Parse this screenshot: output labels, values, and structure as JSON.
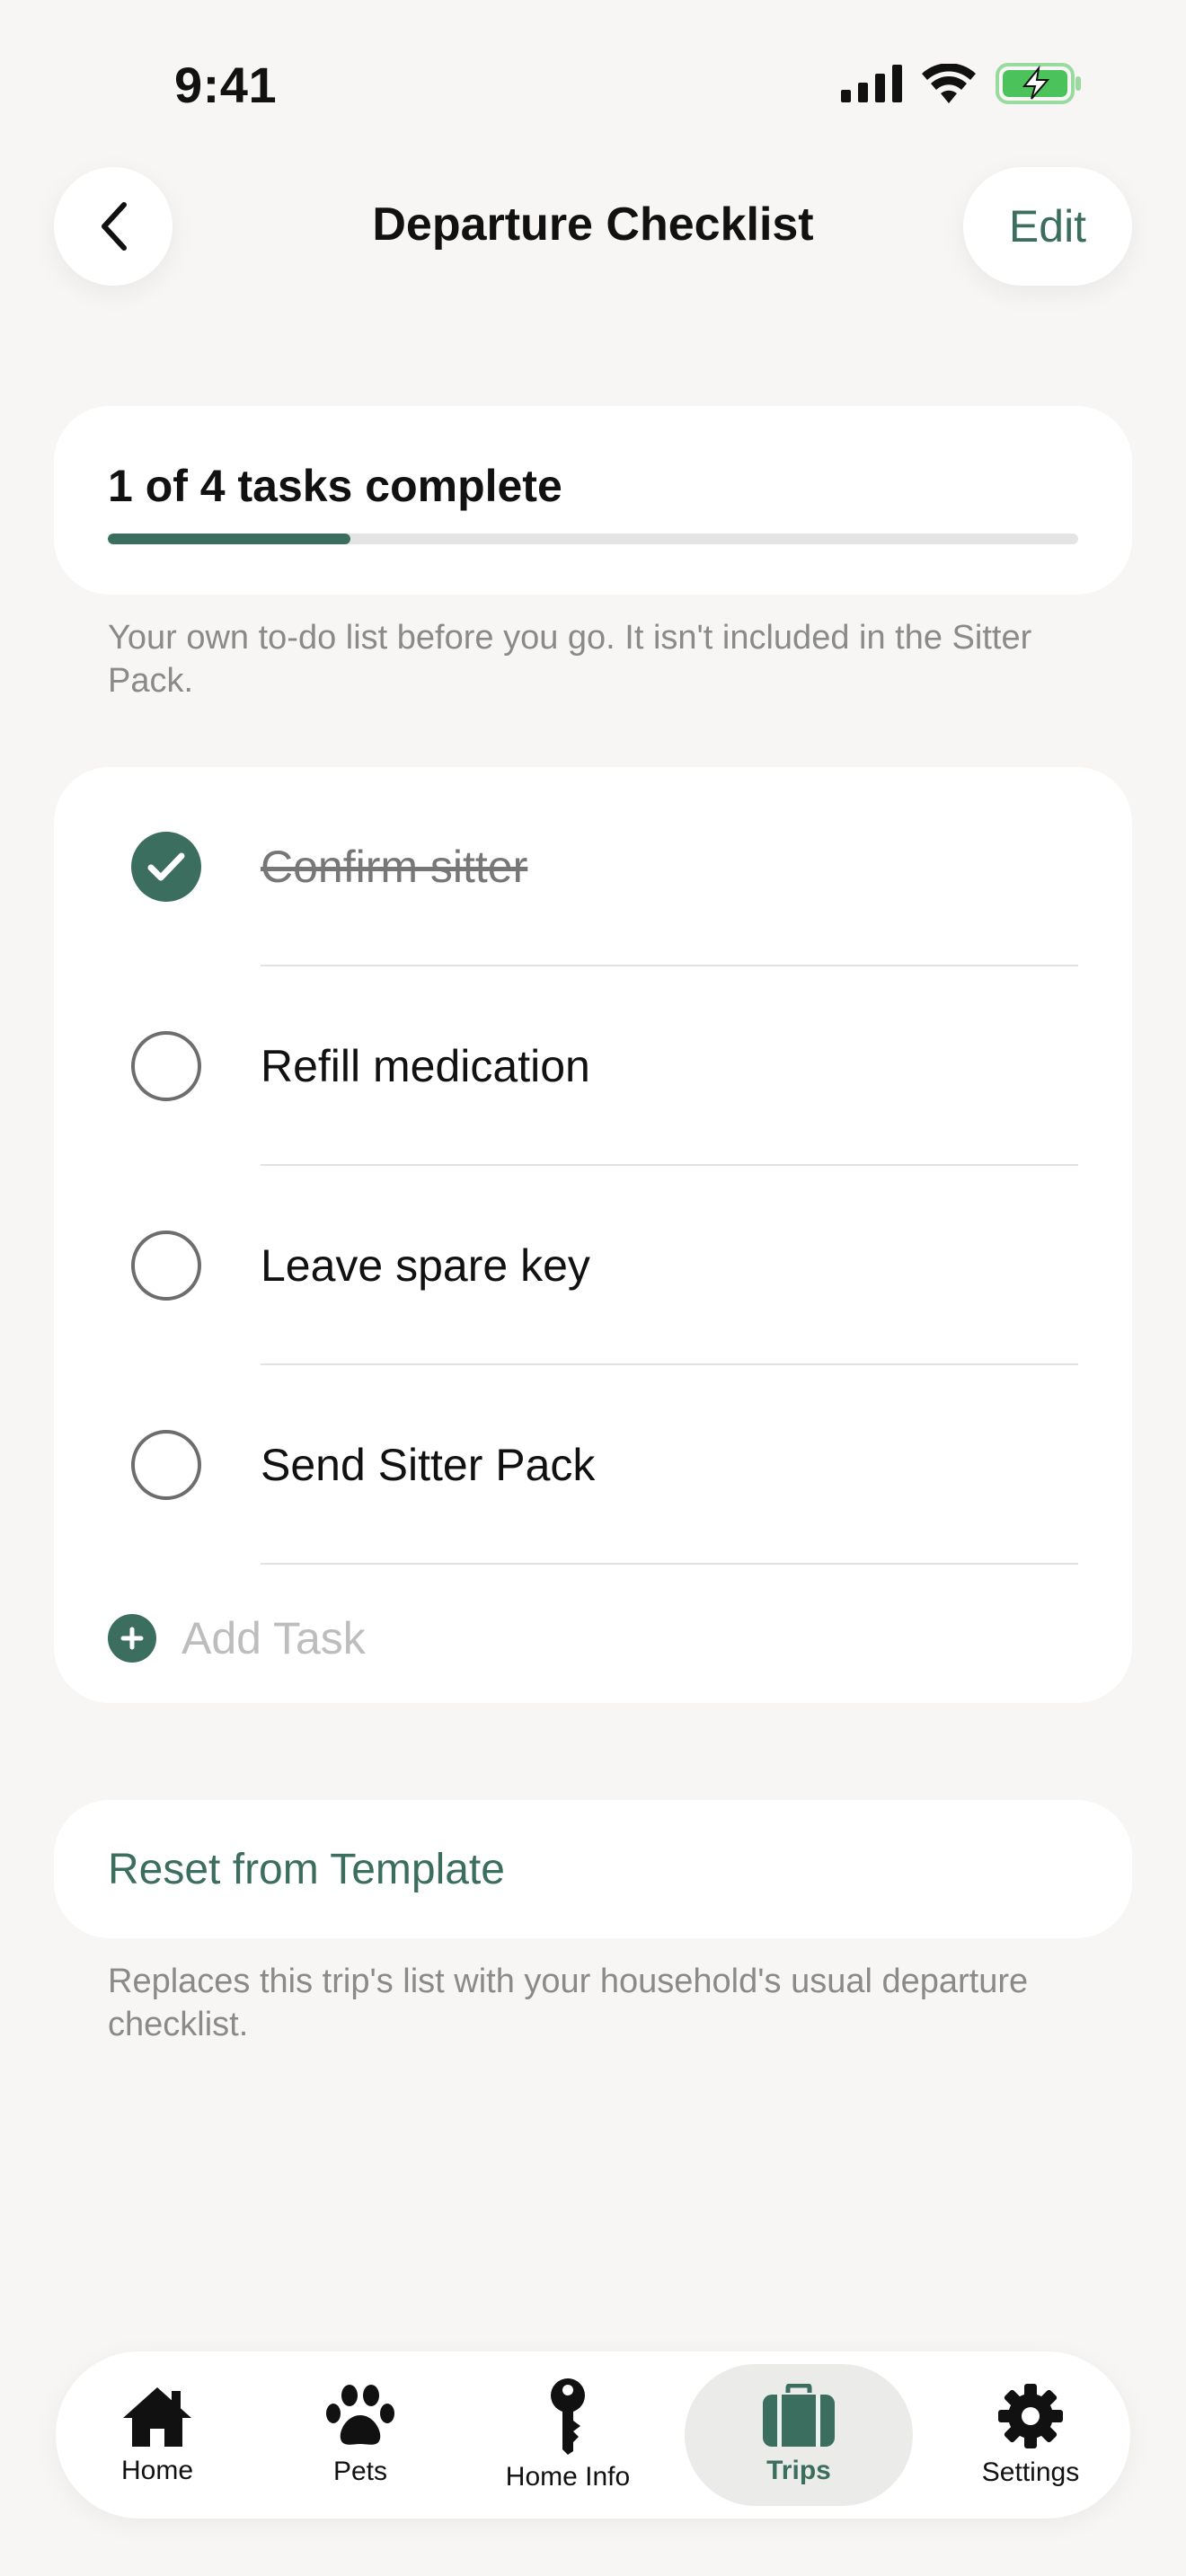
{
  "status_bar": {
    "time": "9:41"
  },
  "header": {
    "title": "Departure Checklist",
    "edit_label": "Edit"
  },
  "progress": {
    "label": "1 of 4 tasks complete",
    "completed": 1,
    "total": 4,
    "fraction": 0.25
  },
  "captions": {
    "checklist_note": "Your own to-do list before you go. It isn't included in the Sitter Pack.",
    "reset_note": "Replaces this trip's list with your household's usual departure checklist."
  },
  "tasks": [
    {
      "label": "Confirm sitter",
      "done": true
    },
    {
      "label": "Refill medication",
      "done": false
    },
    {
      "label": "Leave spare key",
      "done": false
    },
    {
      "label": "Send Sitter Pack",
      "done": false
    }
  ],
  "add_task": {
    "placeholder": "Add Task"
  },
  "reset": {
    "label": "Reset from Template"
  },
  "tabs": [
    {
      "label": "Home",
      "icon": "house-icon"
    },
    {
      "label": "Pets",
      "icon": "paw-icon"
    },
    {
      "label": "Home Info",
      "icon": "key-icon"
    },
    {
      "label": "Trips",
      "icon": "suitcase-icon",
      "active": true
    },
    {
      "label": "Settings",
      "icon": "gear-icon"
    }
  ],
  "colors": {
    "accent": "#3b6e5f",
    "background": "#f7f6f4",
    "battery": "#4cc35a"
  }
}
